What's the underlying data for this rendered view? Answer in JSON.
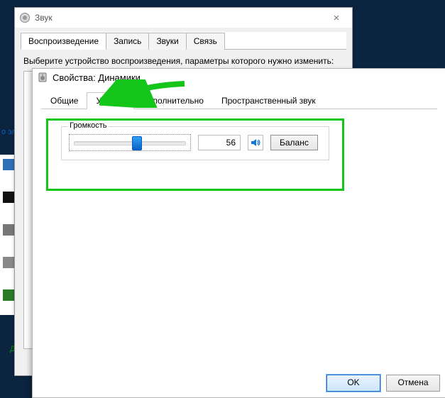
{
  "sound_window": {
    "title": "Звук",
    "tabs": [
      "Воспроизведение",
      "Запись",
      "Звуки",
      "Связь"
    ],
    "selected_tab": 0,
    "instruction": "Выберите устройство воспроизведения, параметры которого нужно изменить:"
  },
  "prop_window": {
    "title": "Свойства: Динамики",
    "tabs": [
      "Общие",
      "Уровни",
      "Дополнительно",
      "Пространственный звук"
    ],
    "selected_tab": 1,
    "volume_group_legend": "Громкость",
    "volume_value": 56,
    "balance_button": "Баланс",
    "ok_label": "OK",
    "cancel_label": "Отмена"
  },
  "left_label": "о эл",
  "dispo_text": "Диспе\nданны",
  "icons": {
    "sound": "speaker-device-icon",
    "prop": "speaker-prop-icon",
    "vol": "volume-icon"
  },
  "colors": {
    "highlight": "#14c51a",
    "accent": "#0a63c8"
  }
}
